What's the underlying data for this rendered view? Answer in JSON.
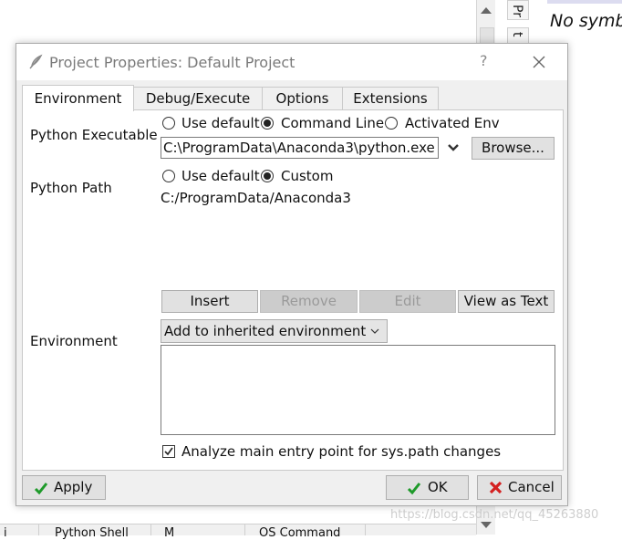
{
  "background": {
    "no_symbol_text": "No symb",
    "side_tab_1": "Pr",
    "side_tab_2": "t",
    "bottom_tab_1": "i",
    "bottom_tab_2": "Python Shell",
    "bottom_tab_3": "M",
    "bottom_tab_4": "OS Command",
    "watermark": "https://blog.csdn.net/qq_45263880"
  },
  "dialog": {
    "title": "Project Properties: Default Project",
    "help_label": "?",
    "tabs": [
      {
        "label": "Environment"
      },
      {
        "label": "Debug/Execute"
      },
      {
        "label": "Options"
      },
      {
        "label": "Extensions"
      }
    ],
    "active_tab": "Environment",
    "python_executable": {
      "label": "Python Executable",
      "options": [
        "Use default",
        "Command Line",
        "Activated Env"
      ],
      "selected": "Command Line",
      "value": "C:\\ProgramData\\Anaconda3\\python.exe",
      "browse_label": "Browse..."
    },
    "python_path": {
      "label": "Python Path",
      "options": [
        "Use default",
        "Custom"
      ],
      "selected": "Custom",
      "value": "C:/ProgramData/Anaconda3",
      "buttons": {
        "insert": "Insert",
        "remove": "Remove",
        "edit": "Edit",
        "view_as_text": "View as Text"
      }
    },
    "environment": {
      "label": "Environment",
      "mode": "Add to inherited environment",
      "value": ""
    },
    "analyze_checkbox": {
      "label": "Analyze main entry point for sys.path changes",
      "checked": true
    },
    "footer": {
      "apply": "Apply",
      "ok": "OK",
      "cancel": "Cancel"
    }
  },
  "colors": {
    "check_green": "#1e9a2a",
    "cancel_red": "#d42020",
    "disabled_text": "#9a9a9a"
  }
}
